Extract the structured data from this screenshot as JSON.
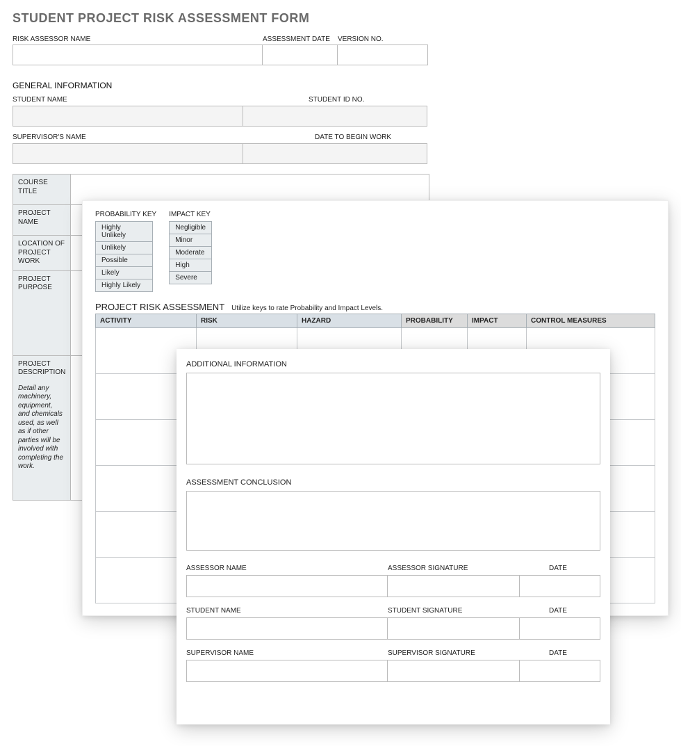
{
  "title": "STUDENT PROJECT RISK ASSESSMENT FORM",
  "topFields": {
    "assessorName": "RISK ASSESSOR NAME",
    "assessmentDate": "ASSESSMENT DATE",
    "versionNo": "VERSION NO."
  },
  "general": {
    "heading": "GENERAL INFORMATION",
    "studentName": "STUDENT NAME",
    "studentId": "STUDENT ID NO.",
    "supervisorName": "SUPERVISOR'S NAME",
    "dateBegin": "DATE TO BEGIN WORK"
  },
  "vtable": {
    "courseTitle": "COURSE TITLE",
    "projectName": "PROJECT NAME",
    "location": "LOCATION OF PROJECT WORK",
    "purpose": "PROJECT PURPOSE",
    "description": "PROJECT DESCRIPTION",
    "descriptionHelp": "Detail any machinery, equipment, and chemicals used, as well as if other parties will be involved with completing the work."
  },
  "keys": {
    "probabilityLabel": "PROBABILITY KEY",
    "probability": [
      "Highly Unlikely",
      "Unlikely",
      "Possible",
      "Likely",
      "Highly Likely"
    ],
    "impactLabel": "IMPACT KEY",
    "impact": [
      "Negligible",
      "Minor",
      "Moderate",
      "High",
      "Severe"
    ]
  },
  "riskSection": {
    "heading": "PROJECT RISK ASSESSMENT",
    "subheading": "Utilize keys to rate Probability and Impact Levels.",
    "headers": [
      "ACTIVITY",
      "RISK",
      "HAZARD",
      "PROBABILITY",
      "IMPACT",
      "CONTROL MEASURES"
    ]
  },
  "page3": {
    "additional": "ADDITIONAL INFORMATION",
    "conclusion": "ASSESSMENT CONCLUSION",
    "sig": [
      {
        "name": "ASSESSOR NAME",
        "sign": "ASSESSOR SIGNATURE",
        "date": "DATE"
      },
      {
        "name": "STUDENT NAME",
        "sign": "STUDENT SIGNATURE",
        "date": "DATE"
      },
      {
        "name": "SUPERVISOR NAME",
        "sign": "SUPERVISOR SIGNATURE",
        "date": "DATE"
      }
    ]
  }
}
